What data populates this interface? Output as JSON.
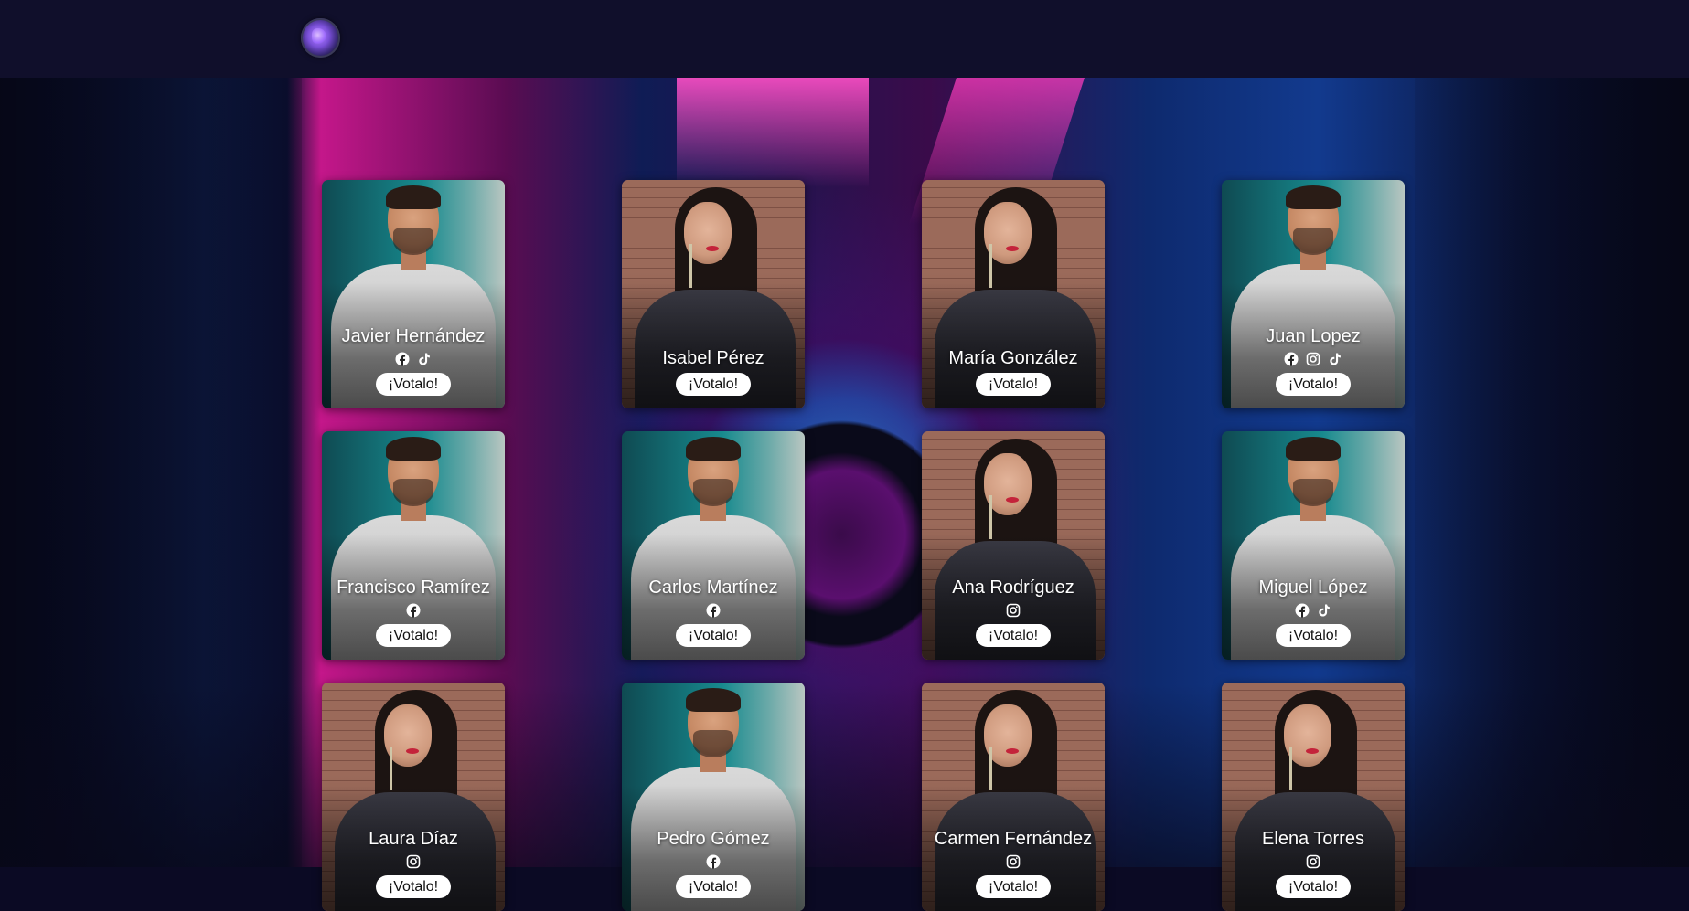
{
  "header": {
    "logo_icon": "circular-purple-logo-icon"
  },
  "contestants": [
    {
      "name": "Javier Hernández",
      "photo": "man-teal",
      "socials": [
        "facebook",
        "tiktok"
      ],
      "vote_label": "¡Votalo!"
    },
    {
      "name": "Isabel Pérez",
      "photo": "woman-brick",
      "socials": [],
      "vote_label": "¡Votalo!"
    },
    {
      "name": "María González",
      "photo": "woman-brick",
      "socials": [],
      "vote_label": "¡Votalo!"
    },
    {
      "name": "Juan Lopez",
      "photo": "man-teal",
      "socials": [
        "facebook",
        "instagram",
        "tiktok"
      ],
      "vote_label": "¡Votalo!"
    },
    {
      "name": "Francisco Ramírez",
      "photo": "man-teal",
      "socials": [
        "facebook"
      ],
      "vote_label": "¡Votalo!"
    },
    {
      "name": "Carlos Martínez",
      "photo": "man-teal",
      "socials": [
        "facebook"
      ],
      "vote_label": "¡Votalo!"
    },
    {
      "name": "Ana Rodríguez",
      "photo": "woman-brick",
      "socials": [
        "instagram"
      ],
      "vote_label": "¡Votalo!"
    },
    {
      "name": "Miguel López",
      "photo": "man-teal",
      "socials": [
        "facebook",
        "tiktok"
      ],
      "vote_label": "¡Votalo!"
    },
    {
      "name": "Laura Díaz",
      "photo": "woman-brick",
      "socials": [
        "instagram"
      ],
      "vote_label": "¡Votalo!"
    },
    {
      "name": "Pedro Gómez",
      "photo": "man-teal",
      "socials": [
        "facebook"
      ],
      "vote_label": "¡Votalo!"
    },
    {
      "name": "Carmen Fernández",
      "photo": "woman-brick",
      "socials": [
        "instagram"
      ],
      "vote_label": "¡Votalo!"
    },
    {
      "name": "Elena Torres",
      "photo": "woman-brick",
      "socials": [
        "instagram"
      ],
      "vote_label": "¡Votalo!"
    }
  ],
  "colors": {
    "navbar": "#100f2b",
    "accent_pink": "#c4178a",
    "accent_blue": "#123a8e",
    "button_bg": "#ffffff"
  }
}
